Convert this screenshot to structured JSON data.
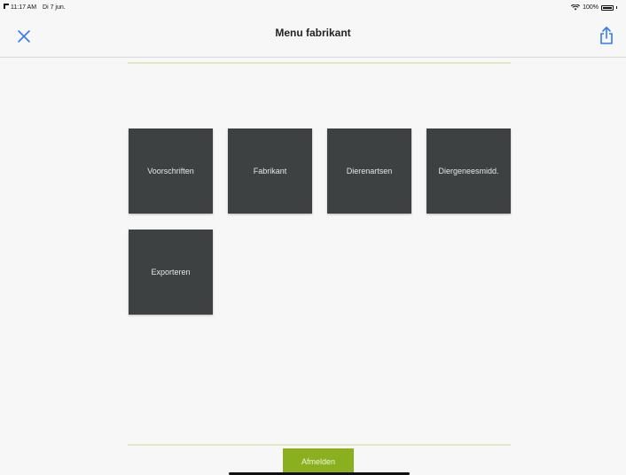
{
  "status_bar": {
    "time": "11:17 AM",
    "date": "Di 7 jun.",
    "battery": "100%"
  },
  "nav": {
    "title": "Menu fabrikant",
    "close_icon": "close-icon",
    "share_icon": "share-icon"
  },
  "menu": {
    "tiles": [
      {
        "label": "Voorschriften"
      },
      {
        "label": "Fabrikant"
      },
      {
        "label": "Dierenartsen"
      },
      {
        "label": "Diergeneesmidd."
      },
      {
        "label": "Exporteren"
      }
    ]
  },
  "footer": {
    "logout_label": "Afmelden"
  },
  "colors": {
    "background": "#f7f7f7",
    "accent": "#3478f6",
    "tile": "#3e4142",
    "logout": "#8ab01f",
    "divider": "#dfe8c4"
  }
}
